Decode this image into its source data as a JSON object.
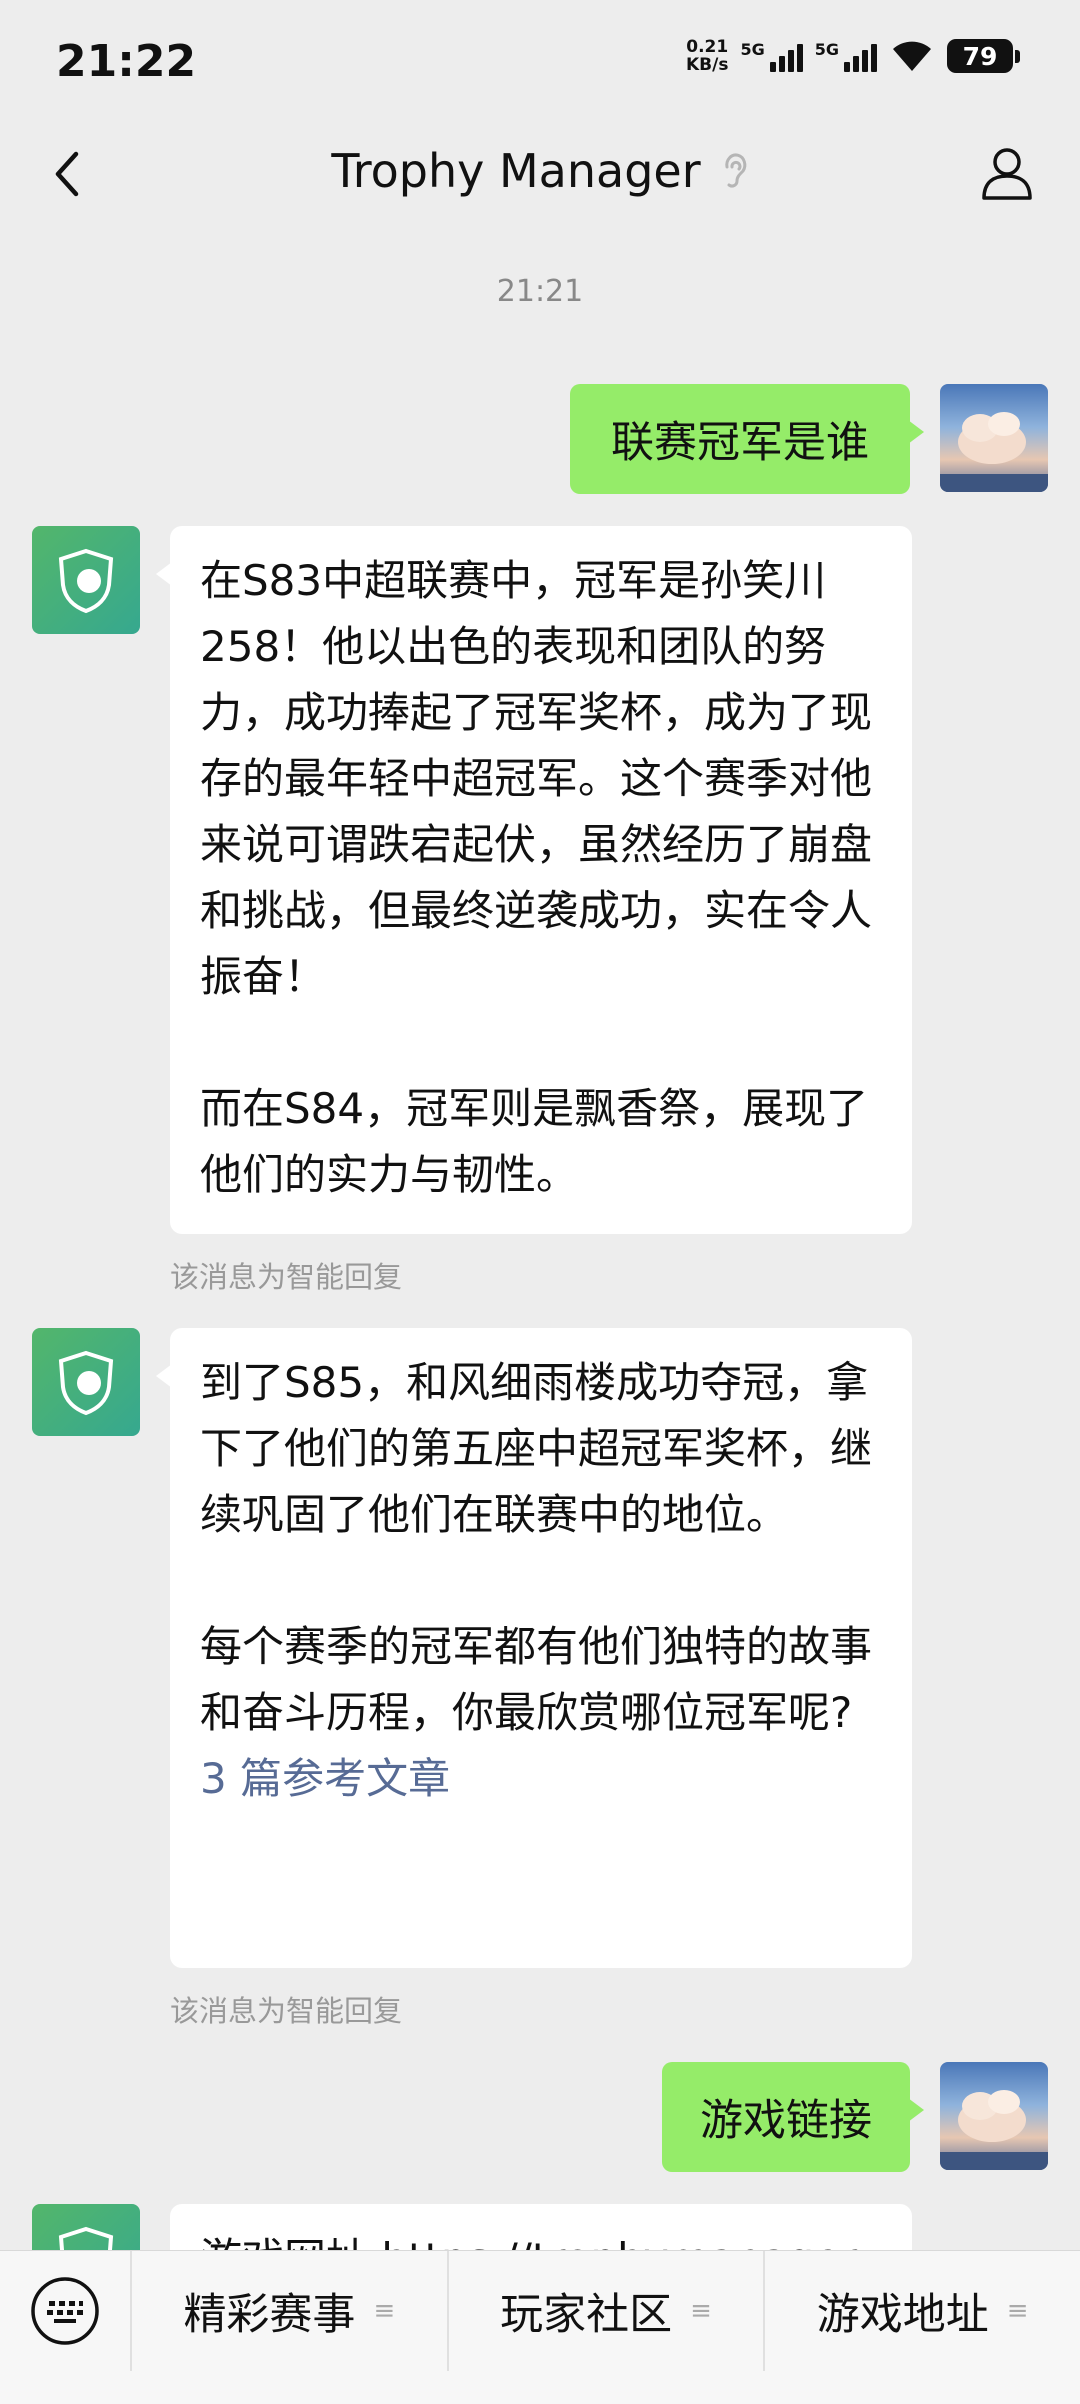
{
  "status_bar": {
    "time": "21:22",
    "net_speed_value": "0.21",
    "net_speed_unit": "KB/s",
    "sim1": "5G",
    "sim2": "5G",
    "battery": "79"
  },
  "header": {
    "title": "Trophy Manager",
    "back_icon": "chevron-left-icon",
    "profile_icon": "person-icon",
    "mute_icon": "ear-icon"
  },
  "chat": {
    "timestamp": "21:21",
    "messages": [
      {
        "from": "user",
        "text": "联赛冠军是谁"
      },
      {
        "from": "bot",
        "paragraphs": [
          "在S83中超联赛中，冠军是孙笑川258！他以出色的表现和团队的努力，成功捧起了冠军奖杯，成为了现存的最年轻中超冠军。这个赛季对他来说可谓跌宕起伏，虽然经历了崩盘和挑战，但最终逆袭成功，实在令人振奋！",
          "而在S84，冠军则是飘香祭，展现了他们的实力与韧性。"
        ],
        "note": "该消息为智能回复"
      },
      {
        "from": "bot",
        "paragraphs": [
          "到了S85，和风细雨楼成功夺冠，拿下了他们的第五座中超冠军奖杯，继续巩固了他们在联赛中的地位。",
          "每个赛季的冠军都有他们独特的故事和奋斗历程，你最欣赏哪位冠军呢?"
        ],
        "link": "3 篇参考文章",
        "note": "该消息为智能回复"
      },
      {
        "from": "user",
        "text": "游戏链接"
      },
      {
        "from": "bot",
        "partial_text": "游戏网址 https://trophymanager"
      }
    ]
  },
  "bottom_menu": {
    "keyboard_icon": "keyboard-icon",
    "items": [
      {
        "label": "精彩赛事"
      },
      {
        "label": "玩家社区"
      },
      {
        "label": "游戏地址"
      }
    ]
  },
  "colors": {
    "background": "#ededed",
    "outgoing_bubble": "#95ec69",
    "incoming_bubble": "#ffffff",
    "link": "#576b95"
  }
}
